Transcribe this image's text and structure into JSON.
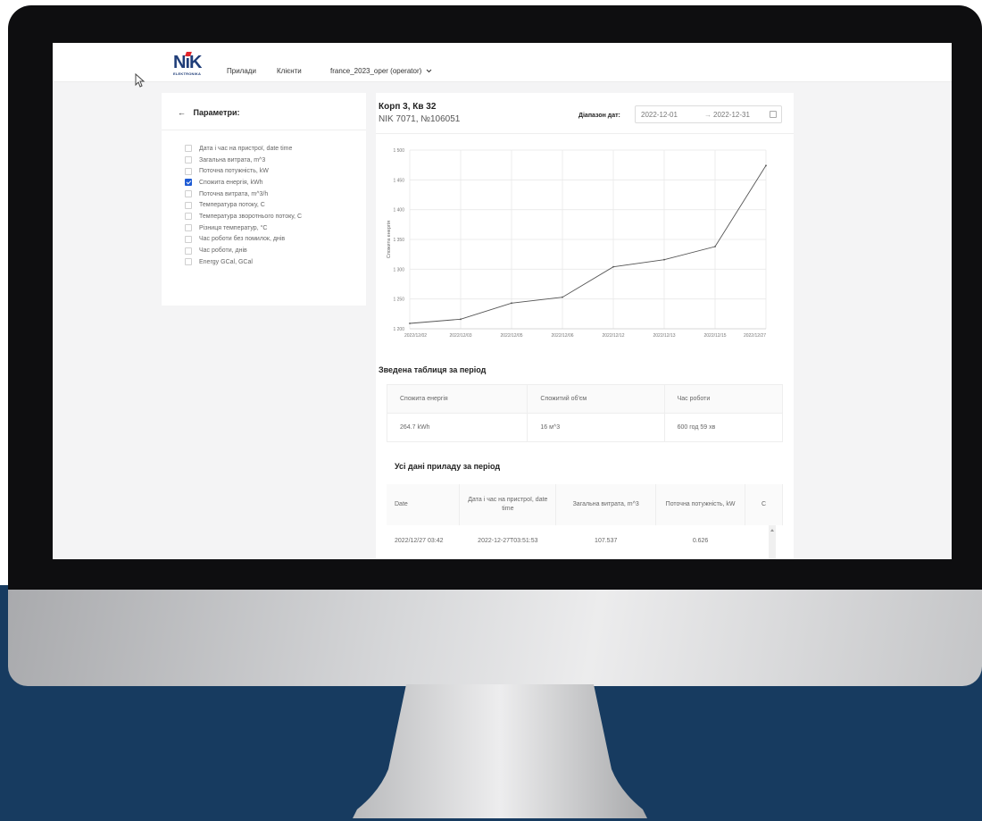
{
  "header": {
    "logo_text": "NiK",
    "logo_sub": "ELEKTRONIKA",
    "nav_items": [
      "Прилади",
      "Клієнти",
      "france_2023_oper (operator)"
    ],
    "user_dropdown_icon": "chevron-down-icon"
  },
  "params": {
    "back_icon": "arrow-left-icon",
    "title": "Параметри:",
    "items": [
      {
        "label": "Дата і час на пристрої, date time",
        "checked": false
      },
      {
        "label": "Загальна витрата, m^3",
        "checked": false
      },
      {
        "label": "Поточна потужність, kW",
        "checked": false
      },
      {
        "label": "Спожита енергія, kWh",
        "checked": true
      },
      {
        "label": "Поточна витрата, m^3/h",
        "checked": false
      },
      {
        "label": "Температура потоку, С",
        "checked": false
      },
      {
        "label": "Температура зворотнього потоку, С",
        "checked": false
      },
      {
        "label": "Різниця температур, °С",
        "checked": false
      },
      {
        "label": "Час роботи без помилок, днів",
        "checked": false
      },
      {
        "label": "Час роботи, днів",
        "checked": false
      },
      {
        "label": "Energy GCal, GCal",
        "checked": false
      }
    ]
  },
  "device": {
    "title": "Корп 3, Кв 32",
    "subtitle": "NIK 7071, №106051",
    "range_label": "Діапазон дат:",
    "date_from": "2022-12-01",
    "range_sep": "→",
    "date_to": "2022-12-31",
    "calendar_icon": "calendar-icon"
  },
  "chart_data": {
    "type": "line",
    "ylabel": "Спожита енергія",
    "xlabel": "",
    "categories": [
      "2022/12/02",
      "2022/12/03",
      "2022/12/05",
      "2022/12/06",
      "2022/12/12",
      "2022/12/13",
      "2022/12/15",
      "2022/12/27"
    ],
    "values": [
      1209,
      1216,
      1243,
      1253,
      1304,
      1316,
      1338,
      1474
    ],
    "ylim": [
      1200,
      1500
    ],
    "yticks": [
      1200,
      1250,
      1300,
      1350,
      1400,
      1450,
      1500
    ],
    "ytick_labels": [
      "1 200",
      "1 250",
      "1 300",
      "1 350",
      "1 400",
      "1 450",
      "1 500"
    ],
    "grid": true,
    "line_color": "#555555"
  },
  "summary": {
    "title": "Зведена таблиця за період",
    "headers": [
      "Спожита енергія",
      "Спожитий об'єм",
      "Час роботи"
    ],
    "values": [
      "264.7 kWh",
      "16 м^3",
      "600 год 59 хв"
    ]
  },
  "all_data": {
    "title": "Усі дані приладу за період",
    "headers": [
      "Date",
      "Дата і час на пристрої, date time",
      "Загальна витрата, m^3",
      "Поточна потужність, kW",
      "С"
    ],
    "rows": [
      [
        "2022/12/27 03:42",
        "2022-12-27T03:51:53",
        "107.537",
        "0.626",
        ""
      ]
    ]
  }
}
